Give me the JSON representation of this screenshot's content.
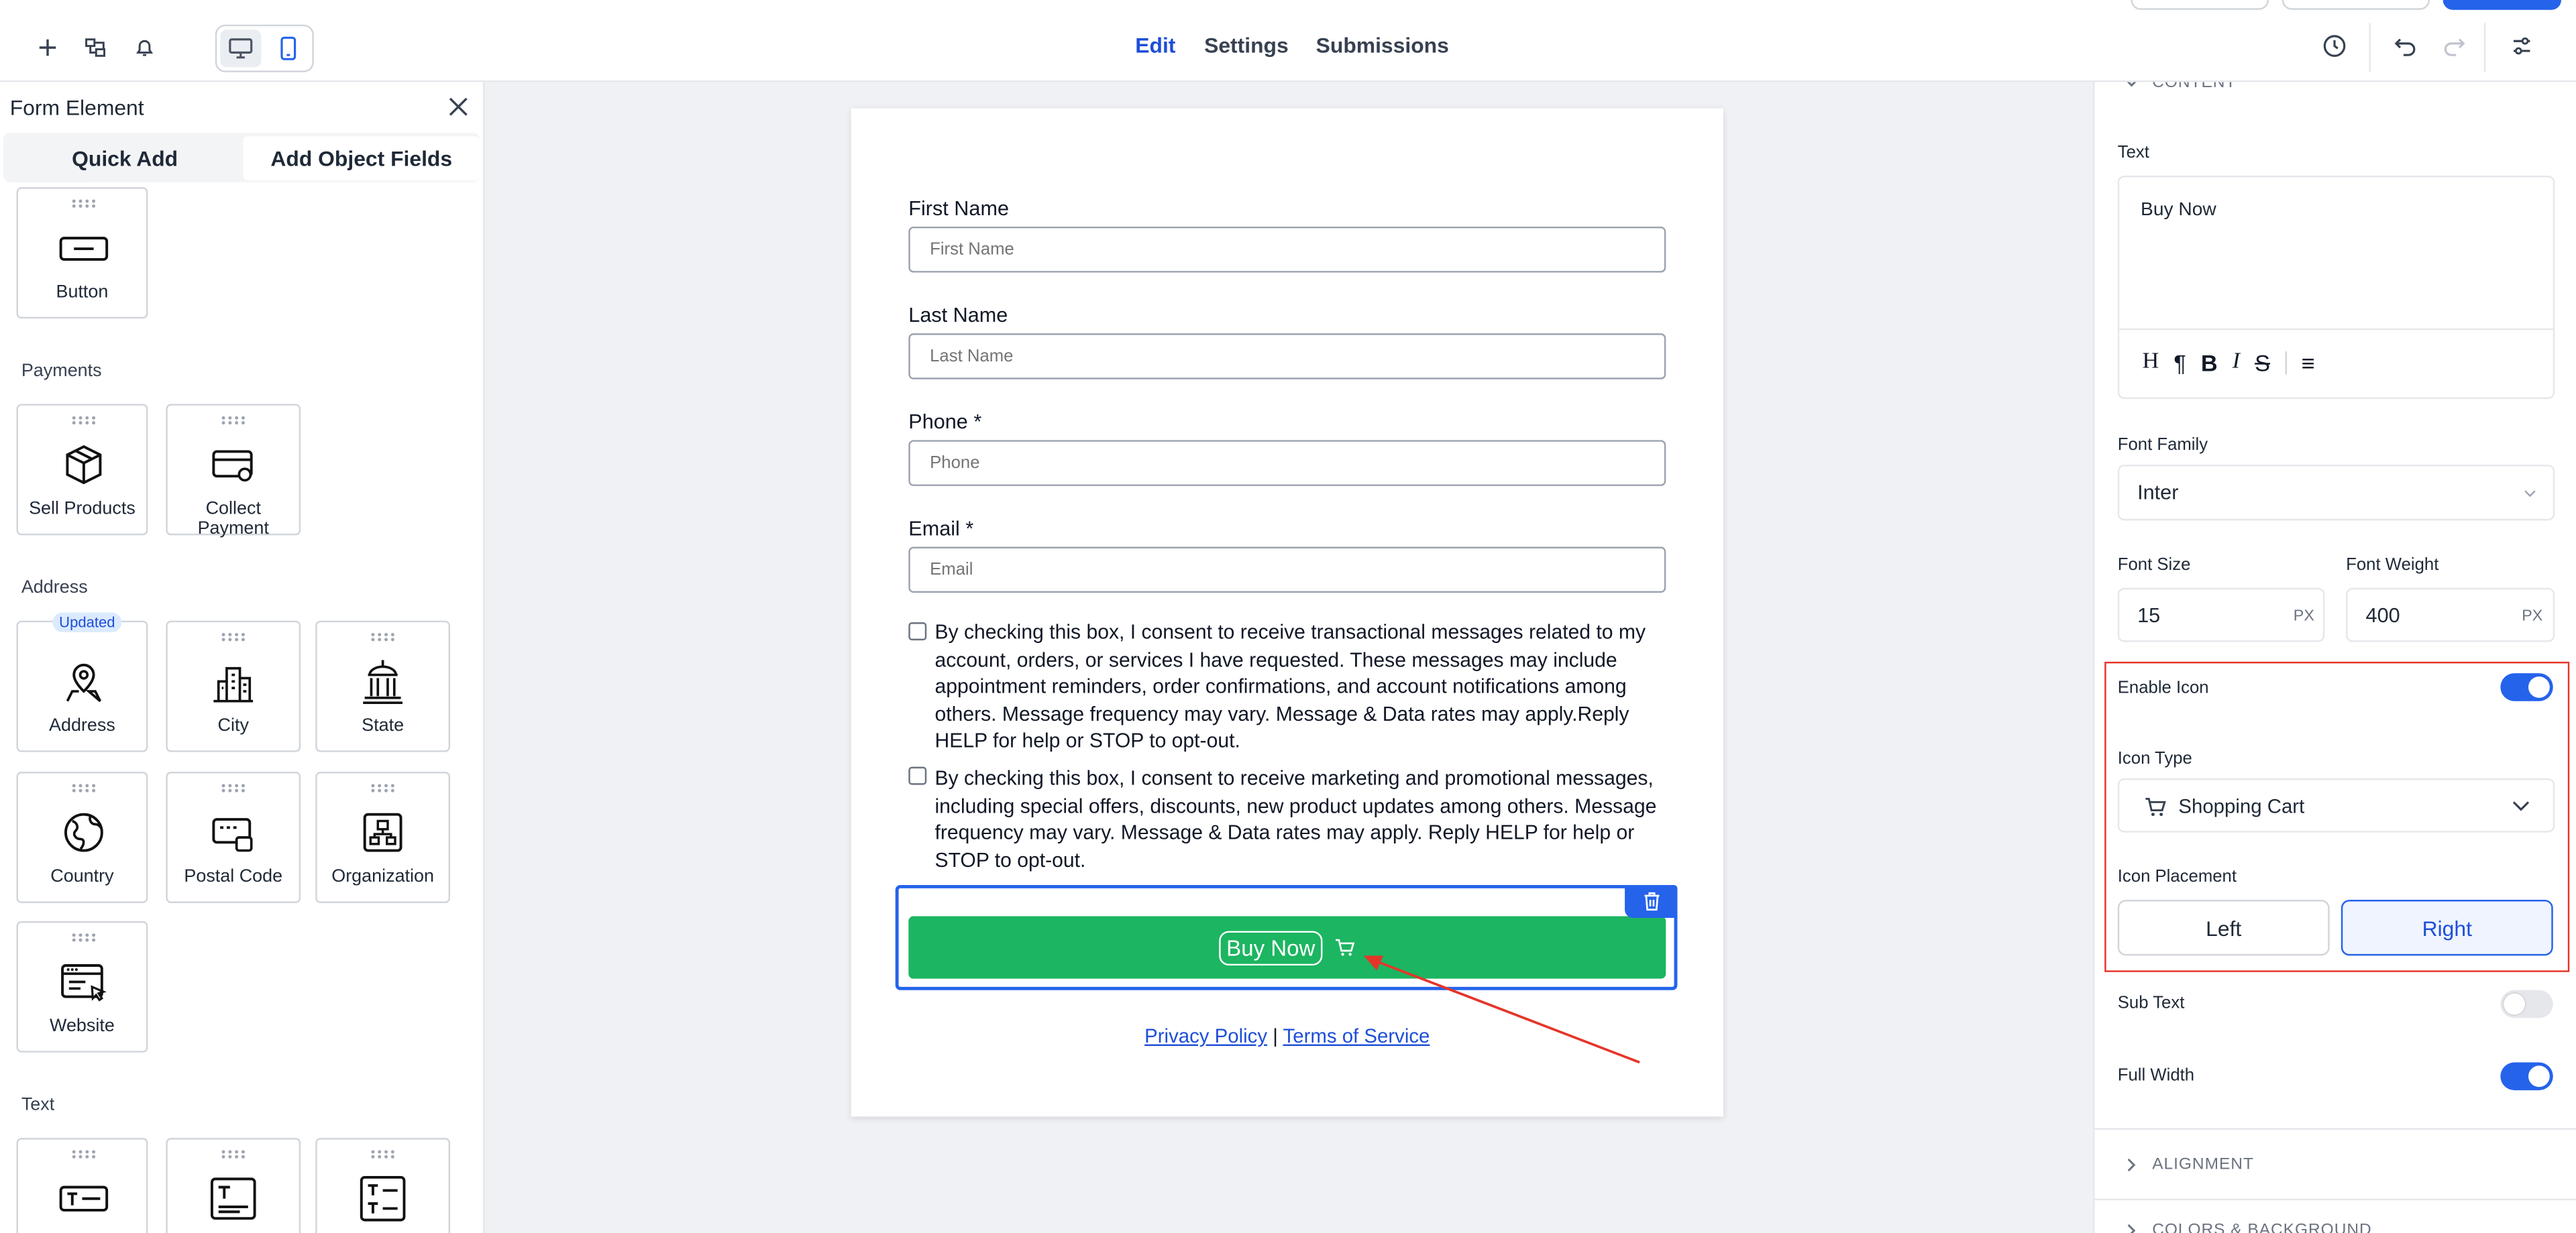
{
  "topbar": {
    "tabs": [
      {
        "label": "Edit",
        "active": true
      },
      {
        "label": "Settings",
        "active": false
      },
      {
        "label": "Submissions",
        "active": false
      }
    ],
    "accent": "#1d4ed8"
  },
  "left_panel": {
    "title": "Form Element",
    "tabs": [
      {
        "label": "Quick Add",
        "active": false
      },
      {
        "label": "Add Object Fields",
        "active": true
      }
    ],
    "top_tile": {
      "label": "Button",
      "icon": "button-icon"
    },
    "sections": [
      {
        "title": "Payments",
        "items": [
          {
            "label": "Sell Products",
            "icon": "package-icon"
          },
          {
            "label": "Collect Payment",
            "icon": "payment-card-icon"
          }
        ]
      },
      {
        "title": "Address",
        "items": [
          {
            "label": "Address",
            "icon": "map-pin-icon",
            "badge": "Updated"
          },
          {
            "label": "City",
            "icon": "city-icon"
          },
          {
            "label": "State",
            "icon": "state-building-icon"
          },
          {
            "label": "Country",
            "icon": "globe-icon"
          },
          {
            "label": "Postal Code",
            "icon": "postal-code-icon"
          },
          {
            "label": "Organization",
            "icon": "organization-icon"
          },
          {
            "label": "Website",
            "icon": "website-icon"
          }
        ]
      },
      {
        "title": "Text",
        "items": [
          {
            "label": "",
            "icon": "single-line-text-icon"
          },
          {
            "label": "",
            "icon": "multi-line-text-icon"
          },
          {
            "label": "",
            "icon": "text-box-list-icon"
          }
        ]
      }
    ]
  },
  "form": {
    "fields": [
      {
        "label": "First Name",
        "placeholder": "First Name"
      },
      {
        "label": "Last Name",
        "placeholder": "Last Name"
      },
      {
        "label": "Phone *",
        "placeholder": "Phone"
      },
      {
        "label": "Email *",
        "placeholder": "Email"
      }
    ],
    "consents": [
      "By checking this box, I consent to receive transactional messages related to my account, orders, or services I have requested. These messages may include appointment reminders, order confirmations, and account notifications among others. Message frequency may vary. Message & Data rates may apply.Reply HELP for help or STOP to opt-out.",
      "By checking this box, I consent to receive marketing and promotional messages, including special offers, discounts, new product updates among others. Message frequency may vary. Message & Data rates may apply. Reply HELP for help or STOP to opt-out."
    ],
    "submit_label": "Buy Now",
    "submit_color": "#1cb561",
    "privacy_link": "Privacy Policy",
    "separator": "|",
    "terms_link": "Terms of Service"
  },
  "right_panel": {
    "content_section": "CONTENT",
    "text_label": "Text",
    "text_value": "Buy Now",
    "font_family_label": "Font Family",
    "font_family_value": "Inter",
    "font_size_label": "Font Size",
    "font_size_value": "15",
    "font_size_unit": "PX",
    "font_weight_label": "Font Weight",
    "font_weight_value": "400",
    "font_weight_unit": "PX",
    "enable_icon_label": "Enable Icon",
    "enable_icon_on": true,
    "icon_type_label": "Icon Type",
    "icon_type_value": "Shopping Cart",
    "icon_placement_label": "Icon Placement",
    "placement_left": "Left",
    "placement_right": "Right",
    "placement_selected": "Right",
    "sub_text_label": "Sub Text",
    "sub_text_on": false,
    "full_width_label": "Full Width",
    "full_width_on": true,
    "alignment_section": "ALIGNMENT",
    "colors_section": "COLORS & BACKGROUND",
    "highlight_color": "#e5352a"
  }
}
